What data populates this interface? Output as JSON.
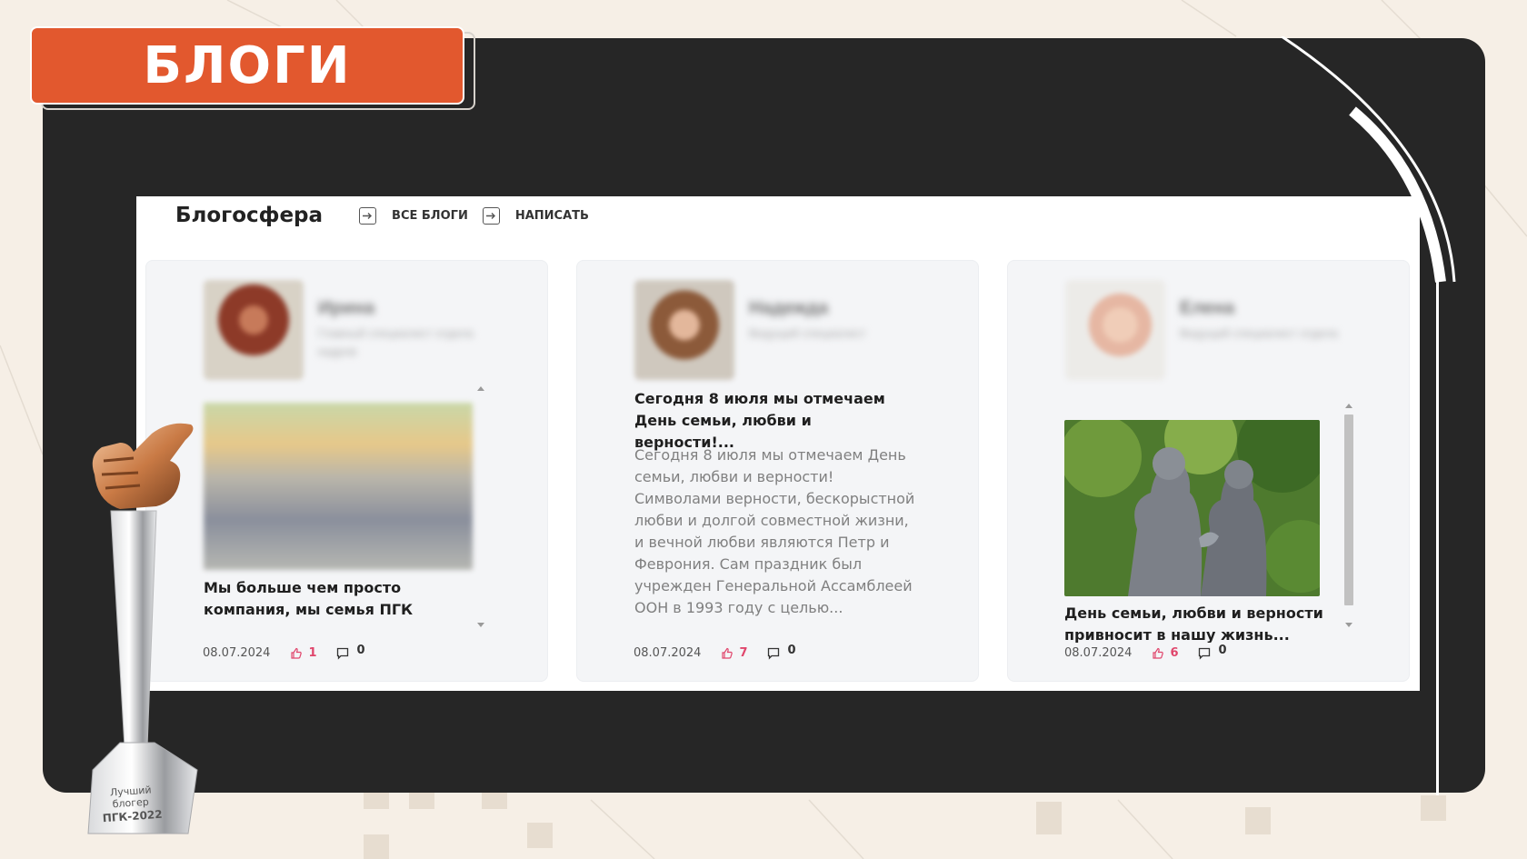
{
  "page": {
    "badge_title": "БЛОГИ"
  },
  "header": {
    "title": "Блогосфера",
    "links": [
      {
        "label": "ВСЕ БЛОГИ"
      },
      {
        "label": "НАПИСАТЬ"
      }
    ]
  },
  "cards": [
    {
      "author_name": "Ирина",
      "author_role": "Главный специалист отдела кадров",
      "post_title": "Мы больше чем просто компания, мы семья ПГК",
      "date": "08.07.2024",
      "likes": "1",
      "comments": "0"
    },
    {
      "author_name": "Надежда",
      "author_role": "Ведущий специалист",
      "post_title": "Сегодня 8 июля мы отмечаем День семьи, любви и верности!...",
      "excerpt": "Сегодня 8 июля мы отмечаем День семьи, любви и верности! Символами верности, бескорыстной любви и долгой совместной жизни, и вечной любви являются Петр и Феврония. Сам праздник был учрежден Генеральной Ассамблеей ООН в 1993 году с целью...",
      "date": "08.07.2024",
      "likes": "7",
      "comments": "0"
    },
    {
      "author_name": "Елена",
      "author_role": "Ведущий специалист отдела",
      "post_title": "День семьи, любви и верности привносит в нашу жизнь...",
      "date": "08.07.2024",
      "likes": "6",
      "comments": "0"
    }
  ],
  "trophy": {
    "engraving": "Лучший блогер ПГК-2022"
  },
  "colors": {
    "accent": "#e2582e",
    "dark_panel": "#262626",
    "like": "#e0466c"
  },
  "icons": [
    "arrow-right-box-icon",
    "like-icon",
    "comment-icon",
    "scroll-up-icon",
    "scroll-down-icon",
    "trophy-thumbs-up"
  ]
}
